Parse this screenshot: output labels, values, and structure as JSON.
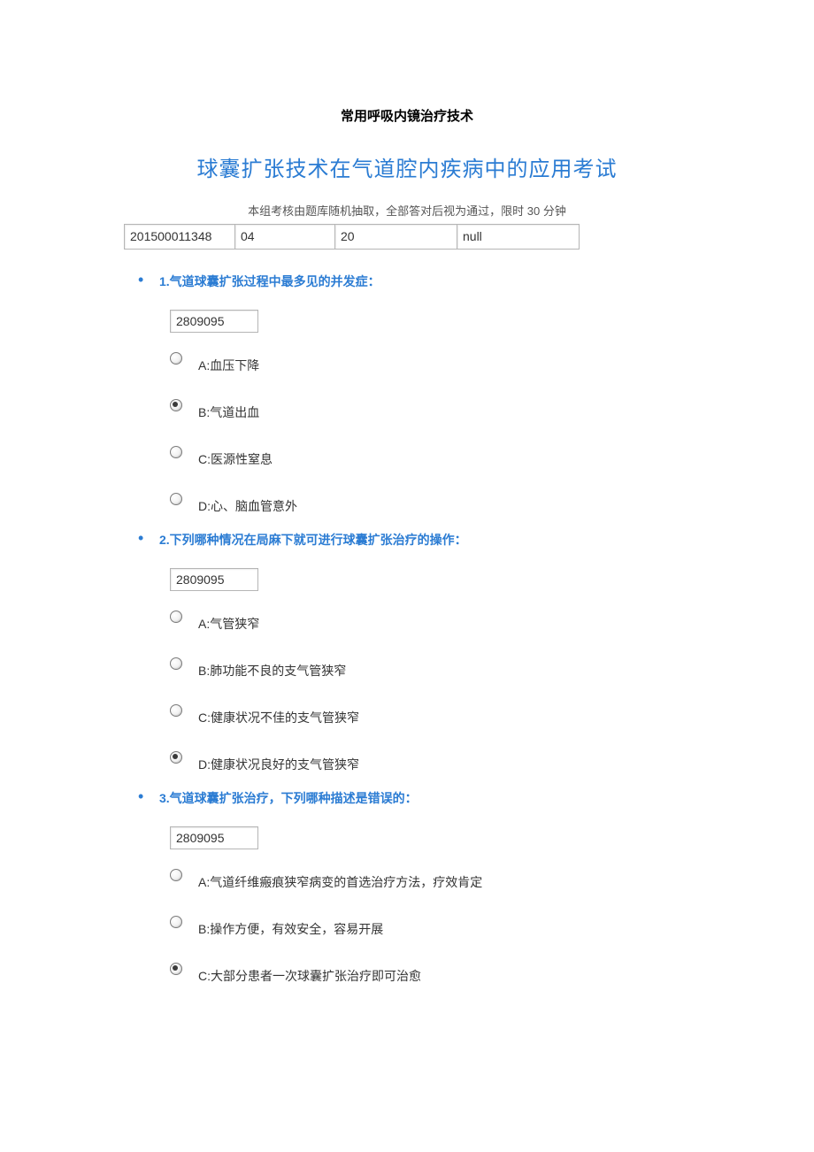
{
  "doc_title": "常用呼吸内镜治疗技术",
  "main_title": "球囊扩张技术在气道腔内疾病中的应用考试",
  "subtitle": "本组考核由题库随机抽取，全部答对后视为通过，限时 30 分钟",
  "info": {
    "c1": "201500011348",
    "c2": "04",
    "c3": "20",
    "c4": "null"
  },
  "questions": [
    {
      "text": "1.气道球囊扩张过程中最多见的并发症：",
      "qid": "2809095",
      "selected": 1,
      "options": [
        "A:血压下降",
        "B:气道出血",
        "C:医源性窒息",
        "D:心、脑血管意外"
      ]
    },
    {
      "text": "2.下列哪种情况在局麻下就可进行球囊扩张治疗的操作：",
      "qid": "2809095",
      "selected": 3,
      "options": [
        "A:气管狭窄",
        "B:肺功能不良的支气管狭窄",
        "C:健康状况不佳的支气管狭窄",
        "D:健康状况良好的支气管狭窄"
      ]
    },
    {
      "text": "3.气道球囊扩张治疗，下列哪种描述是错误的：",
      "qid": "2809095",
      "selected": 2,
      "options": [
        "A:气道纤维瘢痕狭窄病变的首选治疗方法，疗效肯定",
        "B:操作方便，有效安全，容易开展",
        "C:大部分患者一次球囊扩张治疗即可治愈"
      ]
    }
  ]
}
